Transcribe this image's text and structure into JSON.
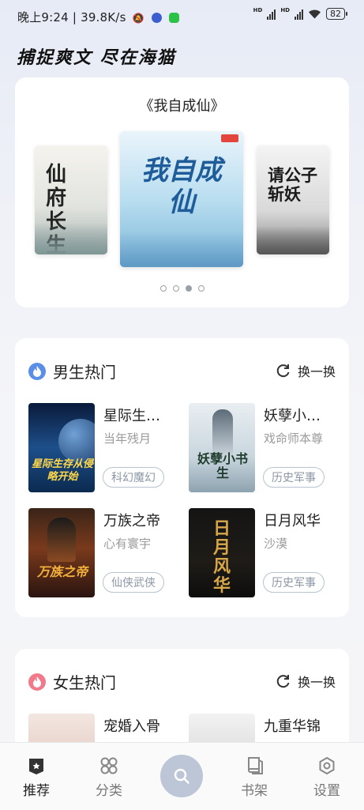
{
  "status_bar": {
    "time": "晚上9:24 | 39.8K/s",
    "battery": "82"
  },
  "slogan": "捕捉爽文 尽在海猫",
  "featured": {
    "title": "《我自成仙》",
    "covers": [
      {
        "title": "仙府长生"
      },
      {
        "title": "我自成仙"
      },
      {
        "title": "请公子斩妖"
      }
    ],
    "dots": 4,
    "active_dot": 3
  },
  "male_section": {
    "title": "男生热门",
    "refresh_label": "换一换",
    "books": [
      {
        "title": "星际生…",
        "author": "当年残月",
        "genre": "科幻魔幻",
        "cover_text": "星际生存从侵略开始"
      },
      {
        "title": "妖孽小…",
        "author": "戏命师本尊",
        "genre": "历史军事",
        "cover_text": "妖孽小书生"
      },
      {
        "title": "万族之帝",
        "author": "心有寰宇",
        "genre": "仙侠武侠",
        "cover_text": "万族之帝"
      },
      {
        "title": "日月风华",
        "author": "沙漠",
        "genre": "历史军事",
        "cover_text": "日月风华"
      }
    ]
  },
  "female_section": {
    "title": "女生热门",
    "refresh_label": "换一换",
    "books": [
      {
        "title": "宠婚入骨"
      },
      {
        "title": "九重华锦"
      }
    ]
  },
  "bottom_nav": {
    "items": [
      {
        "label": "推荐",
        "icon": "recommend-icon"
      },
      {
        "label": "分类",
        "icon": "category-icon"
      },
      {
        "label": "",
        "icon": "search-icon"
      },
      {
        "label": "书架",
        "icon": "bookshelf-icon"
      },
      {
        "label": "设置",
        "icon": "settings-icon"
      }
    ]
  },
  "colors": {
    "male_flame": "#5b8ee6",
    "female_flame": "#f07a8a",
    "search_button": "#bcc6d6"
  }
}
